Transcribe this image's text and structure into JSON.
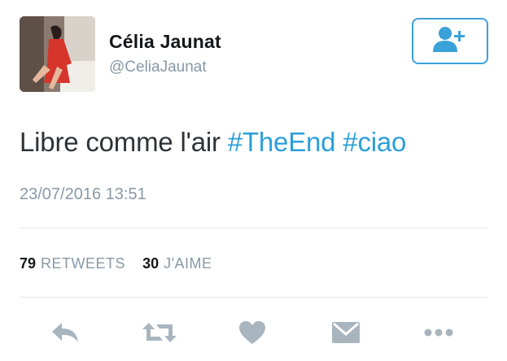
{
  "user": {
    "display_name": "Célia Jaunat",
    "handle": "@CeliaJaunat"
  },
  "follow_button": {
    "icon": "add-user-icon"
  },
  "tweet": {
    "text": "Libre comme l'air",
    "hashtags": [
      "#TheEnd",
      "#ciao"
    ],
    "timestamp": "23/07/2016 13:51"
  },
  "stats": {
    "retweets_count": "79",
    "retweets_label": "RETWEETS",
    "likes_count": "30",
    "likes_label": "J'AIME"
  },
  "actions": [
    {
      "icon": "reply-icon"
    },
    {
      "icon": "retweet-icon"
    },
    {
      "icon": "heart-icon"
    },
    {
      "icon": "message-icon"
    },
    {
      "icon": "more-icon"
    }
  ],
  "colors": {
    "accent": "#2a9fd8",
    "muted": "#8899a6",
    "icon_gray": "#a8b5bf",
    "text": "#2e3338"
  }
}
